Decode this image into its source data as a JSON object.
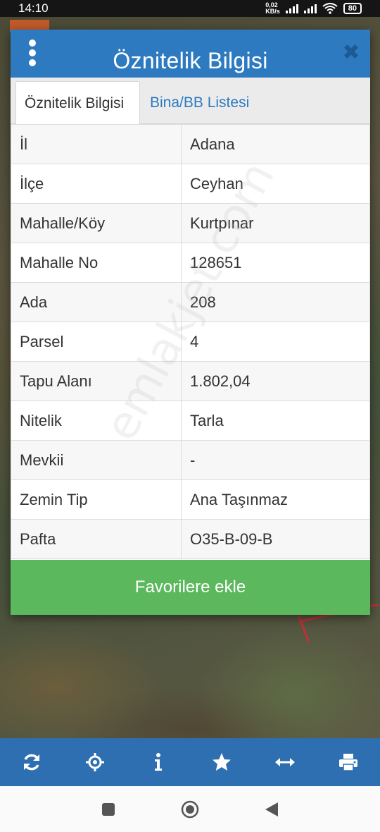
{
  "status_bar": {
    "time": "14:10",
    "net_speed_value": "0,02",
    "net_speed_unit": "KB/s",
    "battery": "80"
  },
  "dialog": {
    "title": "Öznitelik Bilgisi",
    "tabs": [
      {
        "label": "Öznitelik Bilgisi",
        "active": true
      },
      {
        "label": "Bina/BB Listesi",
        "active": false
      }
    ],
    "rows": [
      {
        "label": "İl",
        "value": "Adana"
      },
      {
        "label": "İlçe",
        "value": "Ceyhan"
      },
      {
        "label": "Mahalle/Köy",
        "value": "Kurtpınar"
      },
      {
        "label": "Mahalle No",
        "value": "128651"
      },
      {
        "label": "Ada",
        "value": "208"
      },
      {
        "label": "Parsel",
        "value": "4"
      },
      {
        "label": "Tapu Alanı",
        "value": "1.802,04"
      },
      {
        "label": "Nitelik",
        "value": "Tarla"
      },
      {
        "label": "Mevkii",
        "value": "-"
      },
      {
        "label": "Zemin Tip",
        "value": "Ana Taşınmaz"
      },
      {
        "label": "Pafta",
        "value": "O35-B-09-B"
      }
    ],
    "favorite_button": "Favorilere ekle"
  },
  "watermark": "emlakjet.com",
  "toolbar": {
    "items": [
      "refresh-icon",
      "locate-icon",
      "info-icon",
      "star-icon",
      "measure-icon",
      "print-icon"
    ]
  },
  "colors": {
    "header_blue": "#2d7ac0",
    "toolbar_blue": "#2d6fb0",
    "button_green": "#5cb85c",
    "close_icon": "#1c5a95"
  }
}
